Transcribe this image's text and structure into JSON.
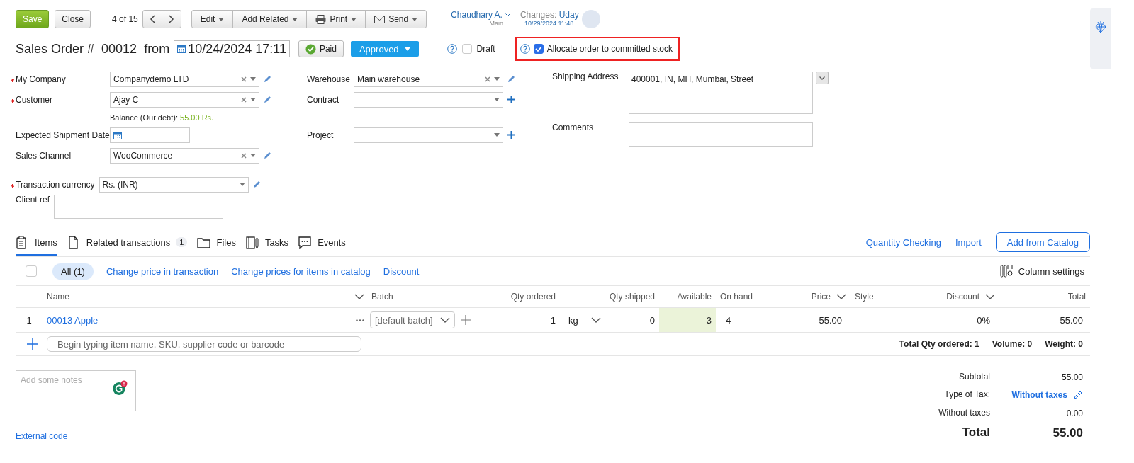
{
  "toolbar": {
    "save": "Save",
    "close": "Close",
    "pager": "4 of 15",
    "menus": [
      "Edit",
      "Add Related",
      "Print",
      "Send"
    ]
  },
  "user": {
    "name": "Chaudhary A.",
    "branch": "Main",
    "changes_label": "Changes:",
    "changes_user": "Uday",
    "changes_time": "10/29/2024 11:48"
  },
  "title": {
    "label": "Sales Order #",
    "number": "00012",
    "from": "from",
    "date": "10/24/2024 17:11",
    "paid": "Paid",
    "status": "Approved",
    "draft": {
      "label": "Draft",
      "checked": false
    },
    "allocate": {
      "label": "Allocate order to committed stock",
      "checked": true
    }
  },
  "form": {
    "left": [
      {
        "label": "My Company",
        "required": true,
        "value": "Companydemo LTD",
        "kind": "select-edit",
        "clearable": true
      },
      {
        "label": "Customer",
        "required": true,
        "value": "Ajay C",
        "kind": "select-edit",
        "clearable": true
      },
      {
        "label": "Expected Shipment Date",
        "required": false,
        "kind": "date"
      },
      {
        "label": "Sales Channel",
        "required": false,
        "value": "WooCommerce",
        "kind": "select-edit",
        "clearable": true
      }
    ],
    "balance": {
      "label": "Balance (Our debt):",
      "amount": "55.00 Rs."
    },
    "extra": [
      {
        "label": "Transaction currency",
        "required": true,
        "value": "Rs. (INR)",
        "kind": "select-edit",
        "clearable": false
      },
      {
        "label": "Client ref",
        "required": false,
        "kind": "textarea"
      }
    ],
    "middle": [
      {
        "label": "Warehouse",
        "required": false,
        "value": "Main warehouse",
        "kind": "select-edit",
        "clearable": true
      },
      {
        "label": "Contract",
        "required": false,
        "kind": "select-add",
        "clearable": false
      },
      {
        "label": "Project",
        "required": false,
        "kind": "select-add",
        "clearable": false
      }
    ],
    "shipping_address": {
      "label": "Shipping Address",
      "value": "400001, IN, MH, Mumbai, Street"
    },
    "comments": {
      "label": "Comments"
    }
  },
  "tabs": [
    {
      "label": "Items",
      "selected": true
    },
    {
      "label": "Related transactions",
      "count": "1",
      "selected": false
    },
    {
      "label": "Files",
      "selected": false
    },
    {
      "label": "Tasks",
      "selected": false
    },
    {
      "label": "Events",
      "selected": false
    }
  ],
  "tab_actions": {
    "links": [
      "Quantity Checking",
      "Import"
    ],
    "button": "Add from Catalog"
  },
  "filters": {
    "select_all_checked": false,
    "chip": {
      "label": "All (1)",
      "selected": true
    },
    "links": [
      "Change price in transaction",
      "Change prices for items in catalog",
      "Discount"
    ],
    "column_settings": "Column settings"
  },
  "table": {
    "columns": [
      {
        "label": "Name",
        "menu": true
      },
      {
        "label": "Batch",
        "menu": false
      },
      {
        "label": "Qty ordered",
        "menu": false
      },
      {
        "label": "Qty shipped",
        "menu": false
      },
      {
        "label": "Available",
        "menu": false
      },
      {
        "label": "On hand",
        "menu": false
      },
      {
        "label": "Price",
        "menu": true
      },
      {
        "label": "Style",
        "menu": false
      },
      {
        "label": "Discount",
        "menu": true
      },
      {
        "label": "Total",
        "menu": false
      }
    ],
    "rows": [
      {
        "index": "1",
        "name": "00013 Apple",
        "batch": "[default batch]",
        "qty": "1",
        "unit": "kg",
        "shipped": "0",
        "available": "3",
        "on_hand": "4",
        "price": "55.00",
        "discount": "0%",
        "total": "55.00"
      }
    ],
    "add_placeholder": "Begin typing item name, SKU, supplier code or barcode",
    "totals": [
      "Total Qty ordered: 1",
      "Volume: 0",
      "Weight: 0"
    ]
  },
  "notes": {
    "placeholder": "Add some notes"
  },
  "external_code": "External code",
  "summary": [
    {
      "label": "Subtotal",
      "value": "55.00",
      "kind": "plain"
    },
    {
      "label": "Type of Tax:",
      "value": "Without taxes",
      "kind": "link"
    },
    {
      "label": "Without taxes",
      "value": "0.00",
      "kind": "plain"
    },
    {
      "label": "Total",
      "value": "55.00",
      "kind": "total"
    }
  ]
}
